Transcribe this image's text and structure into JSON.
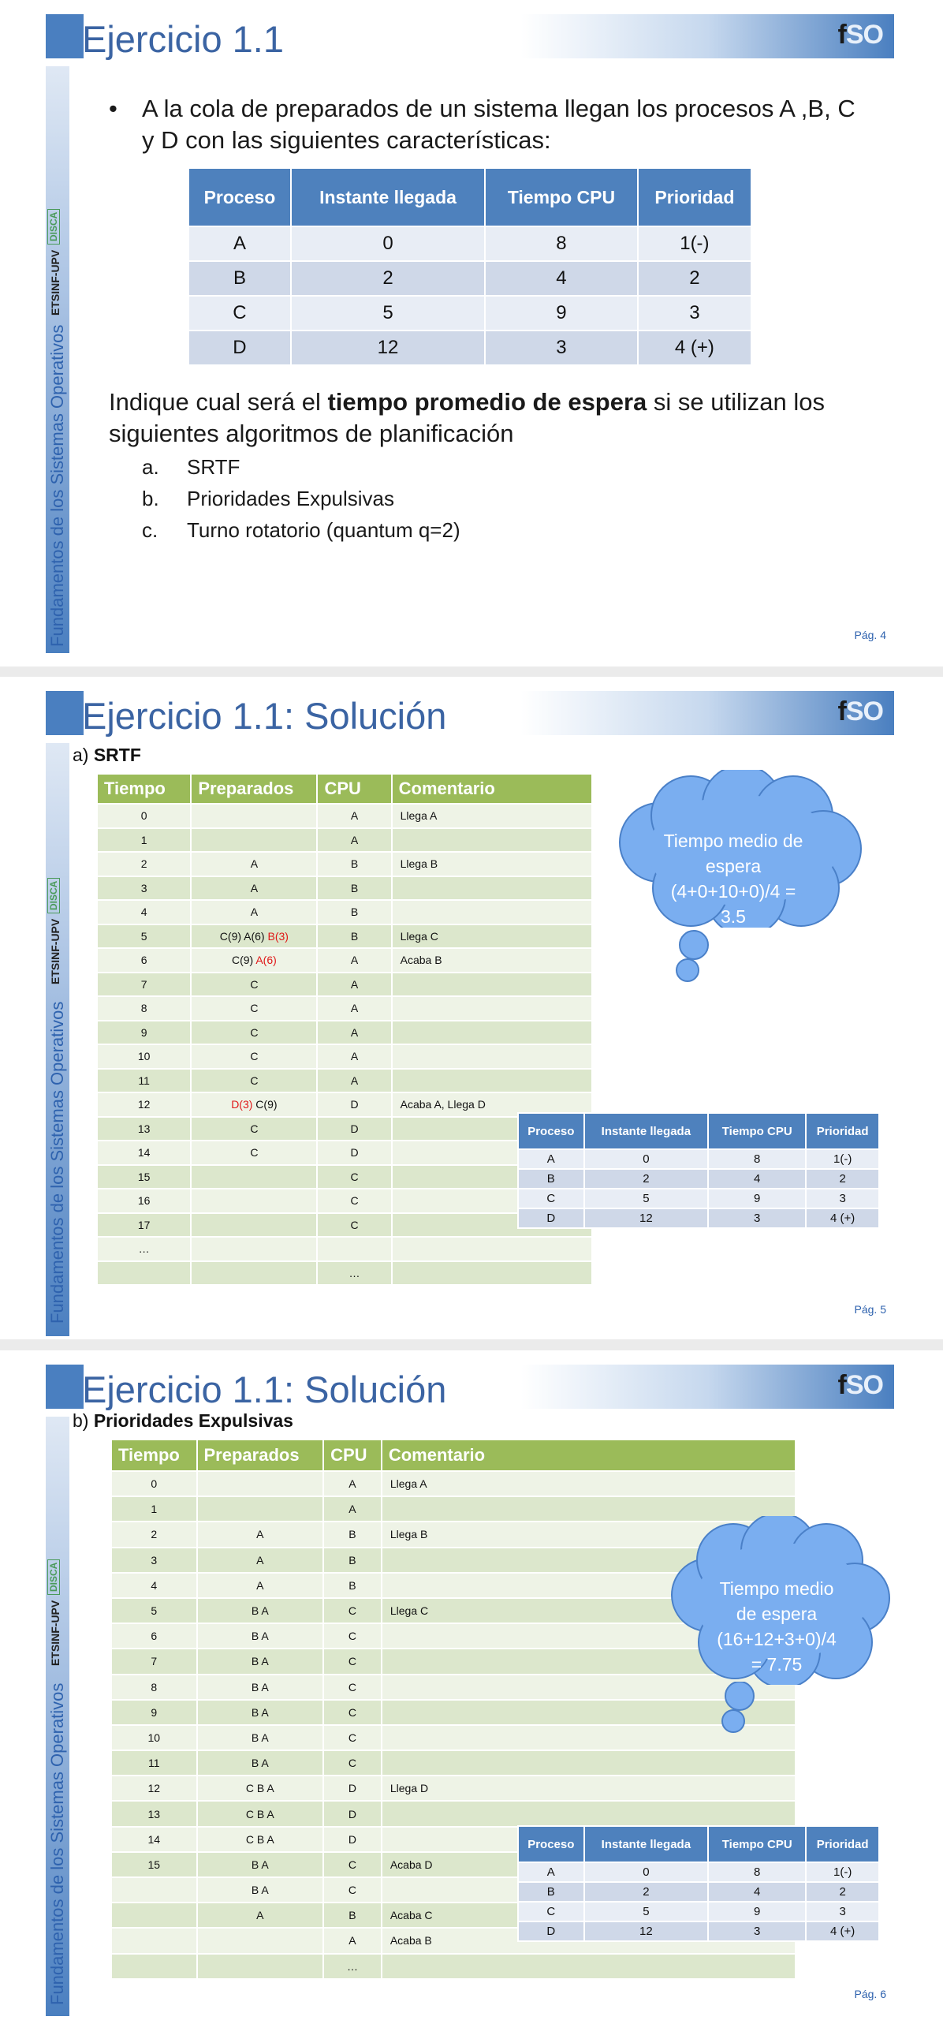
{
  "logo": {
    "f": "f",
    "so": "SO"
  },
  "sidebar": {
    "fund": "Fundamentos de los Sistemas Operativos",
    "etsinf": "ETSINF-UPV",
    "disca": "DISCA"
  },
  "process_table": {
    "headers": [
      "Proceso",
      "Instante llegada",
      "Tiempo CPU",
      "Prioridad"
    ],
    "rows": [
      [
        "A",
        "0",
        "8",
        "1(-)"
      ],
      [
        "B",
        "2",
        "4",
        "2"
      ],
      [
        "C",
        "5",
        "9",
        "3"
      ],
      [
        "D",
        "12",
        "3",
        "4 (+)"
      ]
    ]
  },
  "slide1": {
    "title": "Ejercicio 1.1",
    "bullet": "A la cola de preparados de un sistema llegan los procesos A ,B, C y D con las siguientes características:",
    "question_pre": "Indique cual será el ",
    "question_bold": "tiempo promedio de espera",
    "question_post": " si se utilizan los siguientes algoritmos de planificación",
    "options": [
      {
        "letter": "a.",
        "text": "SRTF"
      },
      {
        "letter": "b.",
        "text": "Prioridades Expulsivas"
      },
      {
        "letter": "c.",
        "text": "Turno rotatorio (quantum q=2)"
      }
    ],
    "page": "Pág. 4"
  },
  "slide2": {
    "title": "Ejercicio 1.1: Solución",
    "sub_prefix": "a) ",
    "sub_bold": "SRTF",
    "headers": [
      "Tiempo",
      "Preparados",
      "CPU",
      "Comentario"
    ],
    "rows": [
      [
        {
          "t": "0"
        },
        {
          "t": ""
        },
        {
          "t": "A"
        },
        {
          "t": "Llega A"
        }
      ],
      [
        {
          "t": "1"
        },
        {
          "t": ""
        },
        {
          "t": "A"
        },
        {
          "t": ""
        }
      ],
      [
        {
          "t": "2"
        },
        {
          "t": "A"
        },
        {
          "t": "B"
        },
        {
          "t": "Llega B"
        }
      ],
      [
        {
          "t": "3"
        },
        {
          "t": "A"
        },
        {
          "t": "B"
        },
        {
          "t": ""
        }
      ],
      [
        {
          "t": "4"
        },
        {
          "t": "A"
        },
        {
          "t": "B"
        },
        {
          "t": ""
        }
      ],
      [
        {
          "t": "5"
        },
        {
          "parts": [
            {
              "t": "C(9) A(6) "
            },
            {
              "t": "B(3)",
              "red": true
            }
          ]
        },
        {
          "t": "B",
          "red": true
        },
        {
          "t": "Llega C"
        }
      ],
      [
        {
          "t": "6"
        },
        {
          "parts": [
            {
              "t": "C(9) "
            },
            {
              "t": "A(6)",
              "red": true
            }
          ]
        },
        {
          "t": "A",
          "red": true
        },
        {
          "t": "Acaba B",
          "red": true
        }
      ],
      [
        {
          "t": "7"
        },
        {
          "t": "C"
        },
        {
          "t": "A"
        },
        {
          "t": ""
        }
      ],
      [
        {
          "t": "8"
        },
        {
          "t": "C"
        },
        {
          "t": "A"
        },
        {
          "t": ""
        }
      ],
      [
        {
          "t": "9"
        },
        {
          "t": "C"
        },
        {
          "t": "A"
        },
        {
          "t": ""
        }
      ],
      [
        {
          "t": "10"
        },
        {
          "t": "C"
        },
        {
          "t": "A"
        },
        {
          "t": ""
        }
      ],
      [
        {
          "t": "11"
        },
        {
          "t": "C"
        },
        {
          "t": "A"
        },
        {
          "t": ""
        }
      ],
      [
        {
          "t": "12"
        },
        {
          "parts": [
            {
              "t": "D(3)",
              "red": true
            },
            {
              "t": " C(9)"
            }
          ]
        },
        {
          "t": "D"
        },
        {
          "t": "Acaba A,  Llega D"
        }
      ],
      [
        {
          "t": "13"
        },
        {
          "t": "C"
        },
        {
          "t": "D"
        },
        {
          "t": ""
        }
      ],
      [
        {
          "t": "14"
        },
        {
          "t": "C"
        },
        {
          "t": "D"
        },
        {
          "t": ""
        }
      ],
      [
        {
          "t": "15"
        },
        {
          "t": ""
        },
        {
          "t": "C"
        },
        {
          "t": ""
        }
      ],
      [
        {
          "t": "16"
        },
        {
          "t": ""
        },
        {
          "t": "C"
        },
        {
          "t": ""
        }
      ],
      [
        {
          "t": "17"
        },
        {
          "t": ""
        },
        {
          "t": "C"
        },
        {
          "t": ""
        }
      ],
      [
        {
          "t": "…"
        },
        {
          "t": ""
        },
        {
          "t": ""
        },
        {
          "t": ""
        }
      ],
      [
        {
          "t": ""
        },
        {
          "t": ""
        },
        {
          "t": "…"
        },
        {
          "t": ""
        }
      ]
    ],
    "cloud_lines": [
      "Tiempo medio de",
      "espera",
      "(4+0+10+0)/4 =",
      "3.5"
    ],
    "page": "Pág. 5"
  },
  "slide3": {
    "title": "Ejercicio 1.1: Solución",
    "sub_prefix": "b) ",
    "sub_bold": "Prioridades Expulsivas",
    "headers": [
      "Tiempo",
      "Preparados",
      "CPU",
      "Comentario"
    ],
    "rows": [
      [
        {
          "t": "0"
        },
        {
          "t": ""
        },
        {
          "t": "A"
        },
        {
          "t": "Llega A"
        }
      ],
      [
        {
          "t": "1"
        },
        {
          "t": ""
        },
        {
          "t": "A"
        },
        {
          "t": ""
        }
      ],
      [
        {
          "t": "2"
        },
        {
          "t": "A"
        },
        {
          "t": "B"
        },
        {
          "t": "Llega B"
        }
      ],
      [
        {
          "t": "3"
        },
        {
          "t": "A"
        },
        {
          "t": "B"
        },
        {
          "t": ""
        }
      ],
      [
        {
          "t": "4"
        },
        {
          "t": "A"
        },
        {
          "t": "B"
        },
        {
          "t": ""
        }
      ],
      [
        {
          "t": "5"
        },
        {
          "t": "B A"
        },
        {
          "t": "C"
        },
        {
          "t": "Llega C"
        }
      ],
      [
        {
          "t": "6"
        },
        {
          "t": "B A"
        },
        {
          "t": "C"
        },
        {
          "t": ""
        }
      ],
      [
        {
          "t": "7"
        },
        {
          "t": "B A"
        },
        {
          "t": "C"
        },
        {
          "t": ""
        }
      ],
      [
        {
          "t": "8"
        },
        {
          "t": "B A"
        },
        {
          "t": "C"
        },
        {
          "t": ""
        }
      ],
      [
        {
          "t": "9"
        },
        {
          "t": "B A"
        },
        {
          "t": "C"
        },
        {
          "t": ""
        }
      ],
      [
        {
          "t": "10"
        },
        {
          "t": "B A"
        },
        {
          "t": "C"
        },
        {
          "t": ""
        }
      ],
      [
        {
          "t": "11"
        },
        {
          "t": "B A"
        },
        {
          "t": "C"
        },
        {
          "t": ""
        }
      ],
      [
        {
          "t": "12"
        },
        {
          "t": "C B A"
        },
        {
          "t": "D"
        },
        {
          "t": "Llega D"
        }
      ],
      [
        {
          "t": "13"
        },
        {
          "t": "C B A"
        },
        {
          "t": "D"
        },
        {
          "t": ""
        }
      ],
      [
        {
          "t": "14"
        },
        {
          "t": "C B A"
        },
        {
          "t": "D"
        },
        {
          "t": ""
        }
      ],
      [
        {
          "t": "15"
        },
        {
          "t": "B A"
        },
        {
          "t": "C"
        },
        {
          "t": "Acaba D"
        }
      ],
      [
        {
          "t": ""
        },
        {
          "t": "B A"
        },
        {
          "t": "C"
        },
        {
          "t": ""
        }
      ],
      [
        {
          "t": ""
        },
        {
          "t": "A"
        },
        {
          "t": "B"
        },
        {
          "t": "Acaba C"
        }
      ],
      [
        {
          "t": ""
        },
        {
          "t": ""
        },
        {
          "t": "A"
        },
        {
          "t": "Acaba B"
        }
      ],
      [
        {
          "t": ""
        },
        {
          "t": ""
        },
        {
          "t": "…"
        },
        {
          "t": ""
        }
      ]
    ],
    "cloud_lines": [
      "Tiempo medio",
      "de espera",
      "(16+12+3+0)/4",
      "= 7.75"
    ],
    "page": "Pág. 6"
  },
  "colors": {
    "title_blue": "#3b64a3",
    "table_blue": "#4e81bd",
    "sched_green": "#9bbb59",
    "cloud_blue": "#7aaef0",
    "highlight_red": "#e01818"
  }
}
